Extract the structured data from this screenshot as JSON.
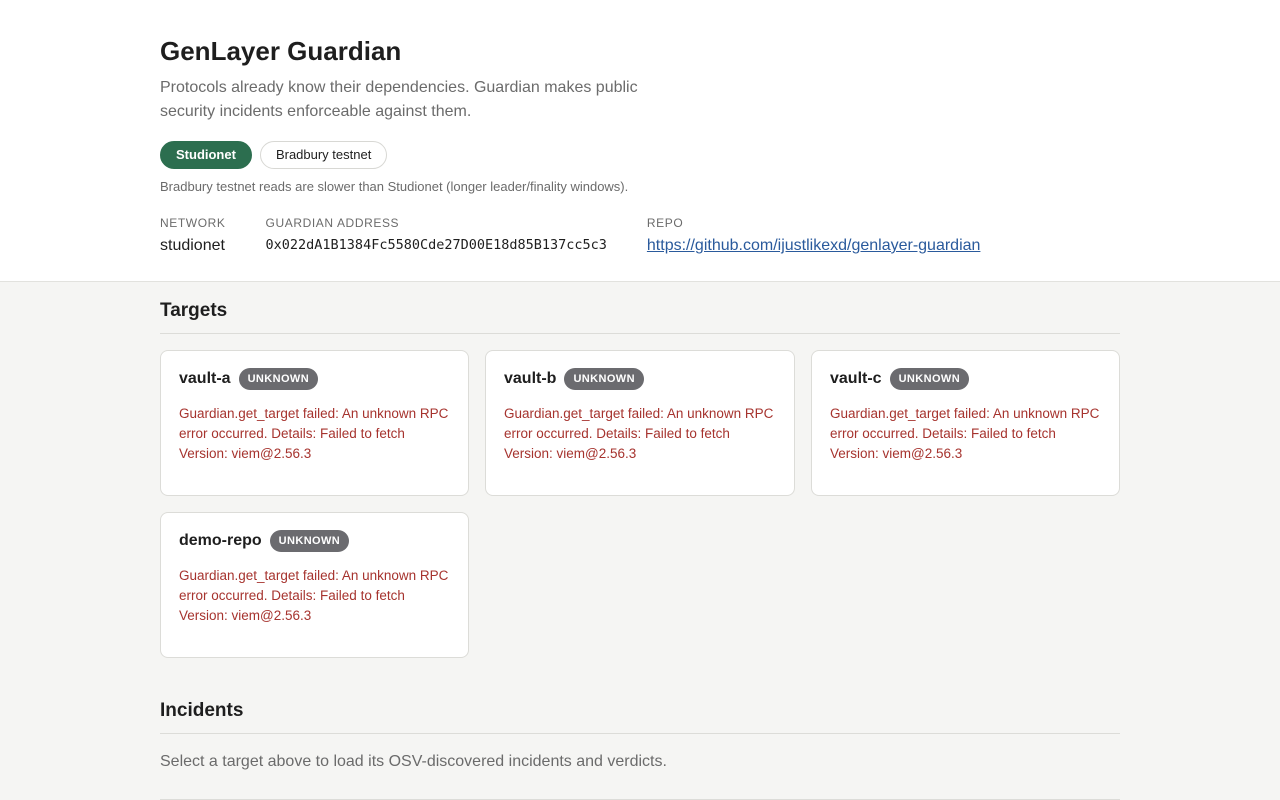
{
  "header": {
    "title": "GenLayer Guardian",
    "subtitle": "Protocols already know their dependencies. Guardian makes public security incidents enforceable against them.",
    "networks": [
      {
        "label": "Studionet",
        "active": true
      },
      {
        "label": "Bradbury testnet",
        "active": false
      }
    ],
    "note": "Bradbury testnet reads are slower than Studionet (longer leader/finality windows).",
    "meta": {
      "network_label": "NETWORK",
      "network_value": "studionet",
      "address_label": "GUARDIAN ADDRESS",
      "address_value": "0x022dA1B1384Fc5580Cde27D00E18d85B137cc5c3",
      "repo_label": "REPO",
      "repo_value": "https://github.com/ijustlikexd/genlayer-guardian"
    }
  },
  "targets": {
    "title": "Targets",
    "items": [
      {
        "name": "vault-a",
        "status": "UNKNOWN",
        "error": "Guardian.get_target failed: An unknown RPC error occurred. Details: Failed to fetch Version: viem@2.56.3"
      },
      {
        "name": "vault-b",
        "status": "UNKNOWN",
        "error": "Guardian.get_target failed: An unknown RPC error occurred. Details: Failed to fetch Version: viem@2.56.3"
      },
      {
        "name": "vault-c",
        "status": "UNKNOWN",
        "error": "Guardian.get_target failed: An unknown RPC error occurred. Details: Failed to fetch Version: viem@2.56.3"
      },
      {
        "name": "demo-repo",
        "status": "UNKNOWN",
        "error": "Guardian.get_target failed: An unknown RPC error occurred. Details: Failed to fetch Version: viem@2.56.3"
      }
    ]
  },
  "incidents": {
    "title": "Incidents",
    "empty_text": "Select a target above to load its OSV-discovered incidents and verdicts."
  },
  "colors": {
    "accent": "#2c6e4f",
    "error": "#a6332e",
    "badge": "#6b6b6f",
    "link": "#2a5a9c"
  }
}
